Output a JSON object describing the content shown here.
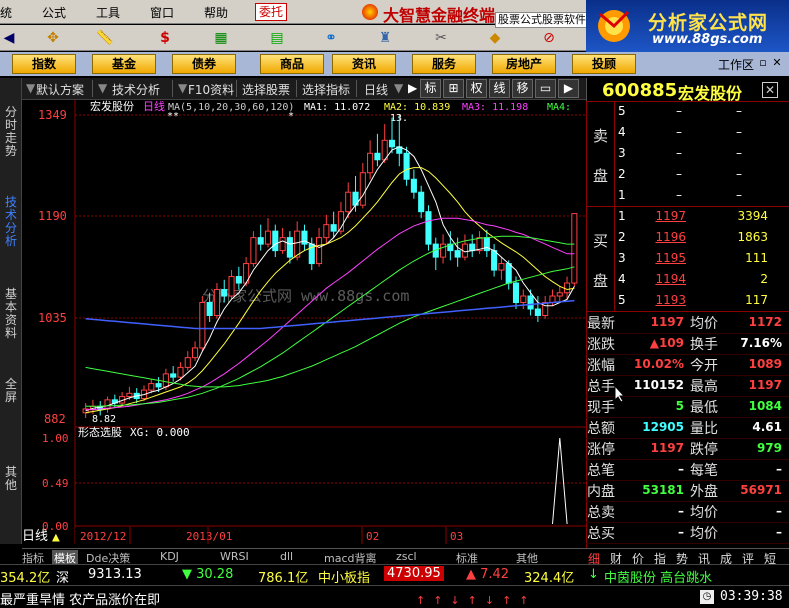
{
  "menu": {
    "items": [
      "统",
      "公式",
      "工具",
      "窗口",
      "帮助"
    ],
    "weituo": "委托",
    "brand": "大智慧金融终端",
    "software_label": "股票公式股票软件"
  },
  "logo": {
    "title": "分析家公式网",
    "url": "www.88gs.com"
  },
  "categories": [
    "指数",
    "基金",
    "债券",
    "商品",
    "资讯",
    "服务",
    "房地产",
    "投顾"
  ],
  "workarea": "工作区",
  "tabs": {
    "scheme": "默认方案",
    "tech": "技术分析",
    "f10": "F10资料",
    "select_stock": "选择股票",
    "select_indicator": "选择指标",
    "period": "日线",
    "btn_biao": "标",
    "btn_quan": "权",
    "btn_xian": "线",
    "btn_yi": "移"
  },
  "left_tabs": [
    "分时走势",
    "技术分析",
    "基本资料",
    "全屏",
    "其他"
  ],
  "chart": {
    "stock": "宏发股份",
    "period": "日线",
    "ma_label": "MA(5,10,20,30,60,120)",
    "ma1": "MA1: 11.072",
    "ma2": "MA2: 10.839",
    "ma3": "MA3: 11.198",
    "ma4": "MA4:",
    "ma1_color": "#ffffff",
    "ma2_color": "#ffff40",
    "ma3_color": "#ff40ff",
    "ma4_color": "#40ff40",
    "high_annot": "13.",
    "low_annot": "8.82",
    "watermark": "分析家公式网  www.88gs.com",
    "y_labels": [
      "1349",
      "1190",
      "1035",
      "882"
    ],
    "sub_title": "形态选股",
    "sub_xg": "XG: 0.000",
    "sub_y": [
      "1.00",
      "0.49",
      "0.00"
    ],
    "x_labels": [
      "2012/12",
      "2013/01",
      "02",
      "03"
    ],
    "period_mark": "日线"
  },
  "chart_data": {
    "type": "candlestick",
    "y_range": [
      882,
      1349
    ],
    "sub_range": [
      0,
      1
    ],
    "candles": [
      [
        890,
        896,
        882,
        905
      ],
      [
        895,
        900,
        888,
        910
      ],
      [
        900,
        895,
        886,
        908
      ],
      [
        896,
        910,
        890,
        915
      ],
      [
        910,
        905,
        898,
        918
      ],
      [
        905,
        915,
        900,
        922
      ],
      [
        915,
        920,
        910,
        930
      ],
      [
        920,
        912,
        905,
        928
      ],
      [
        912,
        925,
        908,
        932
      ],
      [
        925,
        935,
        920,
        942
      ],
      [
        935,
        930,
        922,
        945
      ],
      [
        930,
        950,
        925,
        958
      ],
      [
        950,
        945,
        938,
        962
      ],
      [
        945,
        960,
        940,
        968
      ],
      [
        960,
        975,
        955,
        985
      ],
      [
        975,
        990,
        970,
        1000
      ],
      [
        990,
        1060,
        985,
        1070
      ],
      [
        1060,
        1040,
        1030,
        1075
      ],
      [
        1040,
        1080,
        1035,
        1090
      ],
      [
        1080,
        1070,
        1060,
        1095
      ],
      [
        1070,
        1100,
        1065,
        1110
      ],
      [
        1100,
        1090,
        1080,
        1115
      ],
      [
        1090,
        1120,
        1085,
        1130
      ],
      [
        1120,
        1160,
        1115,
        1170
      ],
      [
        1160,
        1150,
        1140,
        1180
      ],
      [
        1150,
        1170,
        1145,
        1190
      ],
      [
        1170,
        1140,
        1130,
        1180
      ],
      [
        1140,
        1160,
        1135,
        1175
      ],
      [
        1160,
        1130,
        1120,
        1170
      ],
      [
        1130,
        1170,
        1125,
        1185
      ],
      [
        1170,
        1150,
        1140,
        1180
      ],
      [
        1150,
        1120,
        1110,
        1160
      ],
      [
        1120,
        1160,
        1115,
        1175
      ],
      [
        1160,
        1180,
        1150,
        1195
      ],
      [
        1180,
        1170,
        1160,
        1200
      ],
      [
        1170,
        1200,
        1165,
        1215
      ],
      [
        1200,
        1230,
        1190,
        1245
      ],
      [
        1230,
        1210,
        1200,
        1255
      ],
      [
        1210,
        1260,
        1205,
        1275
      ],
      [
        1260,
        1290,
        1250,
        1310
      ],
      [
        1290,
        1280,
        1270,
        1320
      ],
      [
        1280,
        1310,
        1275,
        1335
      ],
      [
        1310,
        1300,
        1290,
        1345
      ],
      [
        1300,
        1290,
        1270,
        1349
      ],
      [
        1290,
        1250,
        1240,
        1300
      ],
      [
        1250,
        1230,
        1220,
        1265
      ],
      [
        1230,
        1200,
        1190,
        1240
      ],
      [
        1200,
        1150,
        1140,
        1210
      ],
      [
        1150,
        1130,
        1110,
        1160
      ],
      [
        1130,
        1150,
        1120,
        1165
      ],
      [
        1150,
        1140,
        1125,
        1170
      ],
      [
        1140,
        1130,
        1115,
        1160
      ],
      [
        1130,
        1150,
        1125,
        1165
      ],
      [
        1150,
        1140,
        1130,
        1165
      ],
      [
        1140,
        1160,
        1135,
        1170
      ],
      [
        1160,
        1140,
        1130,
        1172
      ],
      [
        1140,
        1110,
        1100,
        1150
      ],
      [
        1110,
        1120,
        1095,
        1130
      ],
      [
        1120,
        1090,
        1080,
        1125
      ],
      [
        1090,
        1060,
        1050,
        1100
      ],
      [
        1060,
        1070,
        1050,
        1080
      ],
      [
        1070,
        1050,
        1040,
        1080
      ],
      [
        1050,
        1040,
        1030,
        1070
      ],
      [
        1040,
        1060,
        1035,
        1070
      ],
      [
        1060,
        1070,
        1055,
        1080
      ],
      [
        1070,
        1075,
        1060,
        1085
      ],
      [
        1075,
        1090,
        1065,
        1100
      ],
      [
        1090,
        1197,
        1085,
        1197
      ]
    ],
    "ma5": [
      893,
      897,
      899,
      901,
      905,
      909,
      913,
      916,
      918,
      922,
      925,
      930,
      935,
      942,
      952,
      962,
      985,
      1005,
      1030,
      1050,
      1065,
      1075,
      1090,
      1110,
      1125,
      1140,
      1150,
      1155,
      1150,
      1152,
      1155,
      1150,
      1145,
      1150,
      1160,
      1175,
      1195,
      1210,
      1225,
      1245,
      1265,
      1280,
      1295,
      1300,
      1295,
      1285,
      1265,
      1240,
      1215,
      1180,
      1160,
      1145,
      1138,
      1140,
      1142,
      1145,
      1140,
      1130,
      1120,
      1110,
      1090,
      1075,
      1060,
      1055,
      1055,
      1060,
      1065,
      1085
    ],
    "ma10": [
      890,
      892,
      894,
      896,
      898,
      901,
      904,
      907,
      910,
      914,
      918,
      922,
      926,
      930,
      936,
      944,
      955,
      968,
      982,
      996,
      1012,
      1028,
      1045,
      1062,
      1078,
      1092,
      1105,
      1115,
      1125,
      1133,
      1140,
      1145,
      1148,
      1150,
      1155,
      1160,
      1168,
      1178,
      1190,
      1202,
      1215,
      1230,
      1245,
      1258,
      1265,
      1268,
      1268,
      1262,
      1252,
      1240,
      1228,
      1215,
      1200,
      1188,
      1178,
      1168,
      1160,
      1152,
      1145,
      1138,
      1130,
      1120,
      1110,
      1100,
      1092,
      1085,
      1080,
      1082
    ],
    "ma20": [
      895,
      895,
      896,
      897,
      898,
      899,
      900,
      902,
      904,
      906,
      908,
      910,
      913,
      916,
      920,
      925,
      930,
      936,
      943,
      950,
      958,
      966,
      975,
      984,
      993,
      1002,
      1012,
      1022,
      1032,
      1042,
      1052,
      1062,
      1072,
      1082,
      1090,
      1098,
      1106,
      1115,
      1124,
      1133,
      1142,
      1150,
      1158,
      1166,
      1172,
      1178,
      1182,
      1186,
      1188,
      1190,
      1190,
      1190,
      1188,
      1186,
      1183,
      1180,
      1178,
      1175,
      1172,
      1168,
      1165,
      1160,
      1155,
      1150,
      1145,
      1140,
      1135,
      1135
    ],
    "ma30": [
      900,
      900,
      900,
      901,
      901,
      902,
      902,
      903,
      904,
      905,
      906,
      908,
      910,
      912,
      914,
      917,
      920,
      924,
      928,
      933,
      938,
      943,
      949,
      955,
      961,
      968,
      975,
      982,
      990,
      998,
      1006,
      1014,
      1022,
      1030,
      1038,
      1046,
      1054,
      1062,
      1070,
      1078,
      1086,
      1094,
      1102,
      1110,
      1117,
      1124,
      1130,
      1136,
      1141,
      1145,
      1149,
      1152,
      1155,
      1157,
      1159,
      1160,
      1161,
      1162,
      1162,
      1162,
      1161,
      1160,
      1158,
      1156,
      1154,
      1152,
      1150,
      1150
    ],
    "ma60": [
      960,
      958,
      956,
      954,
      952,
      950,
      948,
      946,
      944,
      942,
      940,
      938,
      936,
      934,
      932,
      931,
      930,
      930,
      930,
      930,
      931,
      932,
      934,
      936,
      938,
      940,
      943,
      946,
      950,
      954,
      958,
      962,
      967,
      972,
      977,
      982,
      987,
      992,
      998,
      1004,
      1010,
      1016,
      1022,
      1028,
      1033,
      1038,
      1042,
      1046,
      1050,
      1054,
      1058,
      1062,
      1066,
      1070,
      1074,
      1078,
      1082,
      1086,
      1090,
      1093,
      1096,
      1099,
      1102,
      1105,
      1108,
      1110,
      1112,
      1115
    ],
    "ma120": [
      1035,
      1034,
      1033,
      1032,
      1031,
      1030,
      1029,
      1028,
      1027,
      1026,
      1025,
      1024,
      1023,
      1022,
      1021,
      1020,
      1020,
      1020,
      1020,
      1020,
      1020,
      1020,
      1020,
      1020,
      1020,
      1021,
      1022,
      1023,
      1024,
      1025,
      1026,
      1027,
      1028,
      1029,
      1030,
      1031,
      1032,
      1033,
      1034,
      1035,
      1036,
      1037,
      1038,
      1039,
      1040,
      1041,
      1042,
      1043,
      1044,
      1045,
      1046,
      1047,
      1048,
      1049,
      1050,
      1051,
      1052,
      1053,
      1054,
      1055,
      1056,
      1057,
      1058,
      1059,
      1060,
      1061,
      1062,
      1063
    ],
    "xg": [
      0,
      0,
      0,
      0,
      0,
      0,
      0,
      0,
      0,
      0,
      0,
      0,
      0,
      0,
      0,
      0,
      0,
      0,
      0,
      0,
      0,
      0,
      0,
      0,
      0,
      0,
      0,
      0,
      0,
      0,
      0,
      0,
      0,
      0,
      0,
      0,
      0,
      0,
      0,
      0,
      0,
      0,
      0,
      0,
      0,
      0,
      0,
      0,
      0,
      0,
      0,
      0,
      0,
      0,
      0,
      0,
      0,
      0,
      0,
      0,
      0,
      0,
      0,
      0,
      0,
      1,
      0,
      0
    ]
  },
  "bottom_tabs": [
    "指标",
    "模板",
    "Dde决策",
    "KDJ",
    "WRSI",
    "dll",
    "macd背离",
    "zscl",
    "标准",
    "其他"
  ],
  "quote": {
    "code": "600885",
    "name": "宏发股份",
    "sell_label1": "卖",
    "sell_label2": "盘",
    "buy_label1": "买",
    "buy_label2": "盘",
    "sells": [
      {
        "n": "5",
        "p": "–",
        "v": "–"
      },
      {
        "n": "4",
        "p": "–",
        "v": "–"
      },
      {
        "n": "3",
        "p": "–",
        "v": "–"
      },
      {
        "n": "2",
        "p": "–",
        "v": "–"
      },
      {
        "n": "1",
        "p": "–",
        "v": "–"
      }
    ],
    "buys": [
      {
        "n": "1",
        "p": "1197",
        "v": "3394"
      },
      {
        "n": "2",
        "p": "1196",
        "v": "1863"
      },
      {
        "n": "3",
        "p": "1195",
        "v": "111"
      },
      {
        "n": "4",
        "p": "1194",
        "v": "2"
      },
      {
        "n": "5",
        "p": "1193",
        "v": "117"
      }
    ],
    "rows": [
      {
        "l1": "最新",
        "v1": "1197",
        "c1": "red",
        "l2": "均价",
        "v2": "1172",
        "c2": "red"
      },
      {
        "l1": "涨跌",
        "v1": "▲109",
        "c1": "red",
        "l2": "换手",
        "v2": "7.16%",
        "c2": "white"
      },
      {
        "l1": "涨幅",
        "v1": "10.02%",
        "c1": "red",
        "l2": "今开",
        "v2": "1089",
        "c2": "red"
      },
      {
        "l1": "总手",
        "v1": "110152",
        "c1": "white",
        "l2": "最高",
        "v2": "1197",
        "c2": "red"
      },
      {
        "l1": "现手",
        "v1": "5",
        "c1": "green",
        "l2": "最低",
        "v2": "1084",
        "c2": "green"
      },
      {
        "l1": "总额",
        "v1": "12905",
        "c1": "cyan",
        "l2": "量比",
        "v2": "4.61",
        "c2": "white"
      },
      {
        "l1": "涨停",
        "v1": "1197",
        "c1": "red",
        "l2": "跌停",
        "v2": "979",
        "c2": "green"
      },
      {
        "l1": "总笔",
        "v1": "–",
        "c1": "white",
        "l2": "每笔",
        "v2": "–",
        "c2": "white"
      },
      {
        "l1": "内盘",
        "v1": "53181",
        "c1": "green",
        "l2": "外盘",
        "v2": "56971",
        "c2": "red"
      },
      {
        "l1": "总卖",
        "v1": "–",
        "c1": "white",
        "l2": "均价",
        "v2": "–",
        "c2": "white"
      },
      {
        "l1": "总买",
        "v1": "–",
        "c1": "white",
        "l2": "均价",
        "v2": "–",
        "c2": "white"
      }
    ]
  },
  "right_tabs": [
    "细",
    "财",
    "价",
    "指",
    "势",
    "讯",
    "成",
    "评",
    "短"
  ],
  "status": {
    "amt1": "354.2亿",
    "shen": "深",
    "shen_idx": "9313.13",
    "shen_chg": "▼ 30.28",
    "shen_amt": "786.1亿",
    "zxb": "中小板指",
    "zxb_idx": "4730.95",
    "zxb_chg": "▲ 7.42",
    "zxb_amt": "324.4亿",
    "news_right": "中茵股份 高台跳水",
    "news_left": "最严重旱情 农产品涨价在即",
    "time": "03:39:38"
  }
}
